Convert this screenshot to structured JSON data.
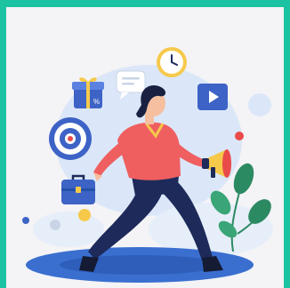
{
  "colors": {
    "frame": "#1cc3a3",
    "card": "#f4f3f6",
    "blob": "#dbe7f8",
    "ground": "#3a6fd0",
    "ground_dark": "#2451a8",
    "shirt": "#ef5f60",
    "pants": "#1d2a5a",
    "skin": "#f6c0a0",
    "hair": "#1a2140",
    "leaf": "#2c8a63",
    "target": "#3d63c6",
    "accent_red": "#e94a4a",
    "accent_yellow": "#f6c94b"
  },
  "icons": [
    "gift-icon",
    "chat-bubble-icon",
    "clock-icon",
    "play-button-icon",
    "target-icon",
    "briefcase-icon",
    "megaphone-icon",
    "plant-icon"
  ]
}
